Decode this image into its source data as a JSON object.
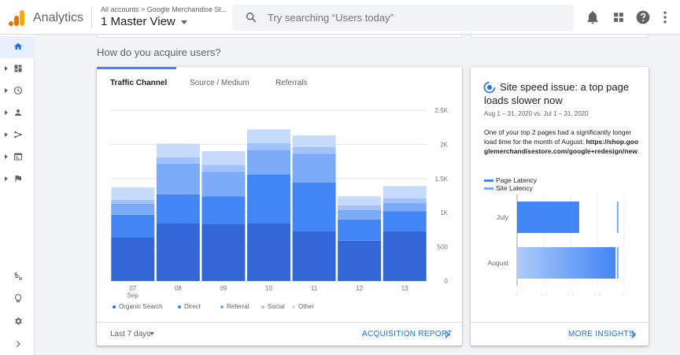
{
  "app": {
    "name": "Analytics",
    "account_path": "All accounts > Google Merchandise St...",
    "view_name": "1 Master View",
    "search_placeholder": "Try searching “Users today”"
  },
  "top_icons": [
    "bell-icon",
    "apps-grid-icon",
    "help-icon",
    "more-vert-icon"
  ],
  "nav_icons": [
    "home-icon",
    "dashboard-icon",
    "clock-icon",
    "person-icon",
    "acquisition-icon",
    "behavior-icon",
    "flag-icon",
    "attribution-icon",
    "lightbulb-icon",
    "gear-icon",
    "expand-icon"
  ],
  "colors": {
    "accent": "#1a73e8",
    "organic": "#3367d6",
    "direct": "#4285f4",
    "referral": "#7baaf7",
    "social": "#a1c2fa",
    "other": "#c6dafc"
  },
  "acquisition": {
    "title": "How do you acquire users?",
    "tabs": [
      "Traffic Channel",
      "Source / Medium",
      "Referrals"
    ],
    "active_tab": 0,
    "footer_range": "Last 7 days",
    "footer_link": "ACQUISITION REPORT"
  },
  "chart_data": {
    "type": "bar",
    "stacked": true,
    "categories": [
      "07",
      "08",
      "09",
      "10",
      "11",
      "12",
      "13"
    ],
    "x_sublabel": "Sep",
    "y_ticks": [
      "0",
      "500",
      "1K",
      "1.5K",
      "2K",
      "2.5K"
    ],
    "ylim": [
      0,
      2500
    ],
    "grid": true,
    "legend_position": "bottom",
    "series": [
      {
        "name": "Organic Search",
        "values": [
          640,
          850,
          830,
          850,
          730,
          590,
          730
        ]
      },
      {
        "name": "Direct",
        "values": [
          330,
          420,
          410,
          710,
          710,
          310,
          290
        ]
      },
      {
        "name": "Referral",
        "values": [
          160,
          450,
          360,
          360,
          420,
          140,
          120
        ]
      },
      {
        "name": "Social",
        "values": [
          60,
          90,
          100,
          100,
          100,
          70,
          70
        ]
      },
      {
        "name": "Other",
        "values": [
          180,
          200,
          200,
          200,
          170,
          130,
          180
        ]
      }
    ]
  },
  "insight": {
    "title": "Site speed issue: a top page loads slower now",
    "dates": "Aug 1 – 31, 2020 vs. Jul 1 – 31, 2020",
    "body_text": "One of your top 2 pages had a significantly longer load time for the month of August:",
    "body_url": "https://shop.googlemerchandisestore.com/google+redesign/new",
    "body_end": ".",
    "legend": [
      "Page Latency",
      "Site Latency"
    ],
    "footer_link": "MORE INSIGHTS",
    "chart": {
      "type": "bar",
      "orientation": "horizontal",
      "categories": [
        "July",
        "August"
      ],
      "x_ticks": [
        "0",
        "1.3",
        "2.5",
        "3.8",
        "5"
      ],
      "xlim": [
        0,
        5
      ],
      "series": [
        {
          "name": "Page Latency",
          "values": [
            2.9,
            4.6
          ]
        },
        {
          "name": "Site Latency",
          "values": [
            4.7,
            4.7
          ]
        }
      ]
    }
  }
}
